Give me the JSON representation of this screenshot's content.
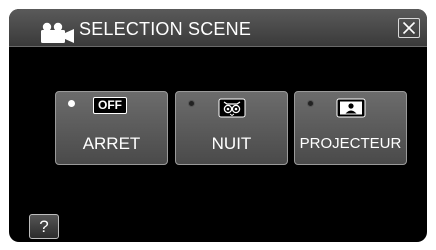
{
  "header": {
    "title": "SELECTION SCENE",
    "icon": "movie-camera-icon",
    "close_icon": "close-icon"
  },
  "options": [
    {
      "label": "ARRET",
      "badge": "OFF",
      "selected": true,
      "icon": "off-icon"
    },
    {
      "label": "NUIT",
      "selected": false,
      "icon": "owl-night-icon"
    },
    {
      "label": "PROJECTEUR",
      "selected": false,
      "icon": "spotlight-icon"
    }
  ],
  "help": {
    "label": "?"
  },
  "colors": {
    "panel_background": "#000000",
    "header_background": "#4a4a4a",
    "button_background": "#5c5c5c",
    "text": "#ffffff"
  }
}
